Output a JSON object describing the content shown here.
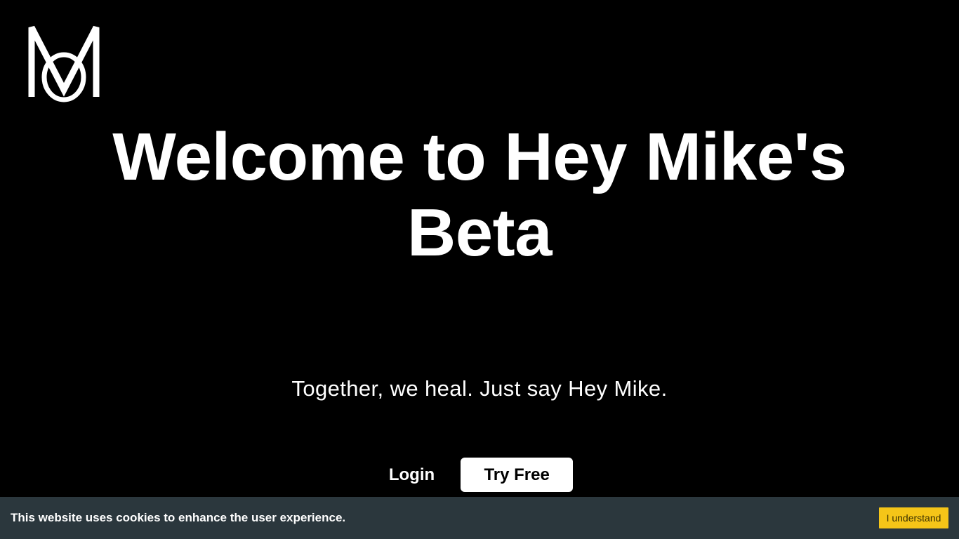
{
  "brand": {
    "logo_icon": "mo-monogram-logo"
  },
  "hero": {
    "title_line1": "Welcome to Hey Mike's",
    "title_line2": "Beta",
    "tagline": "Together, we heal. Just say Hey Mike."
  },
  "actions": {
    "login_label": "Login",
    "try_free_label": "Try Free"
  },
  "cookie_banner": {
    "message": "This website uses cookies to enhance the user experience.",
    "accept_label": "I understand",
    "background": "#2b373d",
    "accent": "#f5c518"
  },
  "colors": {
    "page_background": "#000000",
    "text": "#ffffff"
  }
}
